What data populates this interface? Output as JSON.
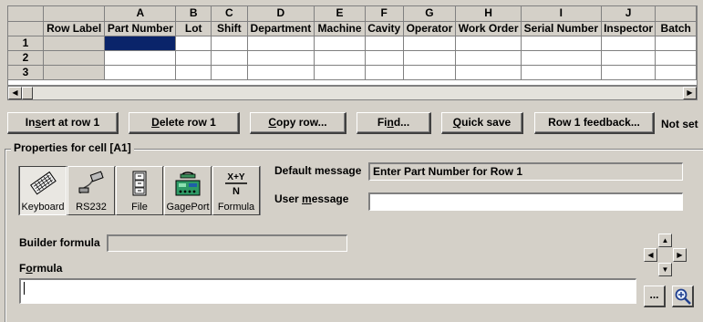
{
  "grid": {
    "column_letters": [
      "",
      "",
      "A",
      "B",
      "C",
      "D",
      "E",
      "F",
      "G",
      "H",
      "I",
      "J",
      ""
    ],
    "column_names": [
      "",
      "Row Label",
      "Part Number",
      "Lot",
      "Shift",
      "Department",
      "Machine",
      "Cavity",
      "Operator",
      "Work Order",
      "Serial Number",
      "Inspector",
      "Batch"
    ],
    "row_numbers": [
      "1",
      "2",
      "3"
    ]
  },
  "buttons": {
    "insert_pre": "In",
    "insert_ul": "s",
    "insert_post": "ert at row 1",
    "delete_ul": "D",
    "delete_post": "elete row 1",
    "copy_ul": "C",
    "copy_post": "opy row...",
    "find_pre": "Fi",
    "find_ul": "n",
    "find_post": "d...",
    "quicksave_ul": "Q",
    "quicksave_post": "uick save",
    "feedback": "Row 1 feedback..."
  },
  "status_text": "Not set",
  "properties": {
    "title": "Properties for cell [A1]",
    "sources": [
      {
        "label": "Keyboard",
        "icon": "keyboard-icon",
        "active": true
      },
      {
        "label": "RS232",
        "icon": "rs232-cable-icon",
        "active": false
      },
      {
        "label": "File",
        "icon": "file-cabinet-icon",
        "active": false
      },
      {
        "label": "GagePort",
        "icon": "gageport-device-icon",
        "active": false
      },
      {
        "label": "Formula",
        "icon": "formula-icon",
        "active": false
      }
    ],
    "default_message_label": "Default message",
    "default_message_value": "Enter Part Number for Row 1",
    "user_message_label_pre": "User ",
    "user_message_label_ul": "m",
    "user_message_label_post": "essage",
    "user_message_value": "",
    "builder_formula_label": "Builder formula",
    "builder_formula_value": "",
    "formula_label_pre": "F",
    "formula_label_ul": "o",
    "formula_label_post": "rmula",
    "formula_value": "",
    "ellipsis_label": "...",
    "formula_icon_text": "X+Y"
  }
}
